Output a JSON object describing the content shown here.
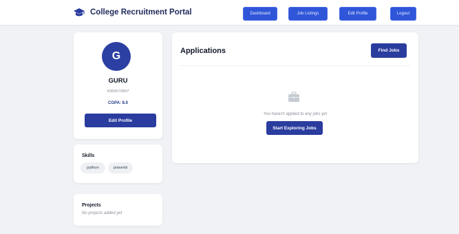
{
  "header": {
    "brand": "College Recruitment Portal",
    "logo_icon": "graduation-cap-icon",
    "nav": {
      "dashboard": "Dashboard",
      "job_listings": "Job Listings",
      "edit_profile": "Edit Profile",
      "logout": "Logout"
    }
  },
  "profile": {
    "initial": "G",
    "name": "GURU",
    "phone": "9360670847",
    "cgpa": "CGPA: 8.0",
    "edit_button": "Edit Profile"
  },
  "skills": {
    "title": "Skills",
    "items": [
      "python",
      "powerbi"
    ]
  },
  "projects": {
    "title": "Projects",
    "empty": "No projects added yet"
  },
  "applications": {
    "title": "Applications",
    "find_jobs": "Find Jobs",
    "empty_icon": "briefcase-icon",
    "empty_message": "You haven't applied to any jobs yet",
    "cta": "Start Exploring Jobs"
  },
  "colors": {
    "primary": "#2a3c9e",
    "nav_button": "#2f56d9",
    "background": "#f1f2f6"
  }
}
